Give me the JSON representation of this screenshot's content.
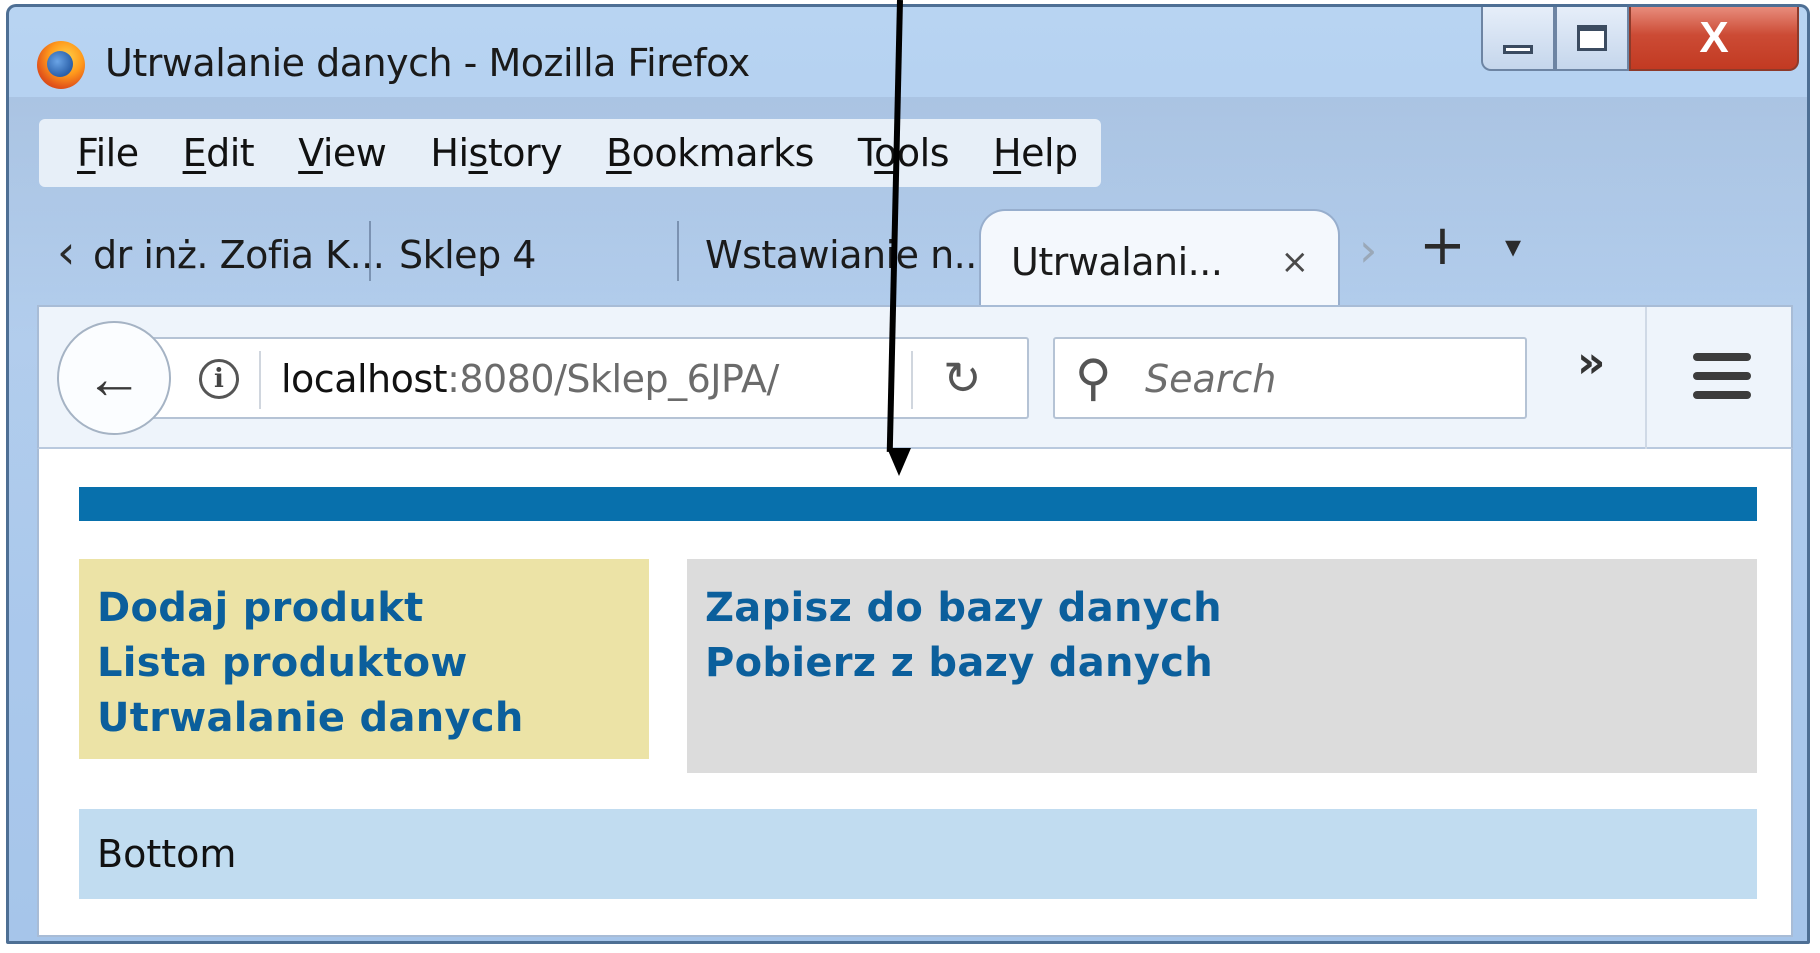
{
  "window": {
    "title": "Utrwalanie danych - Mozilla Firefox",
    "controls": {
      "minimize": "",
      "maximize": "",
      "close": "X"
    }
  },
  "menubar": {
    "items": [
      {
        "label": "File",
        "underline": "F",
        "rest": "ile"
      },
      {
        "label": "Edit",
        "underline": "E",
        "rest": "dit"
      },
      {
        "label": "View",
        "underline": "V",
        "rest": "iew"
      },
      {
        "label": "History",
        "pre": "Hi",
        "underline": "s",
        "rest": "tory"
      },
      {
        "label": "Bookmarks",
        "underline": "B",
        "rest": "ookmarks"
      },
      {
        "label": "Tools",
        "pre": "T",
        "underline": "o",
        "rest": "ols"
      },
      {
        "label": "Help",
        "underline": "H",
        "rest": "elp"
      }
    ]
  },
  "tabs": {
    "items": [
      {
        "label": "dr inż. Zofia K..."
      },
      {
        "label": "Sklep 4"
      },
      {
        "label": "Wstawianie n..."
      },
      {
        "label": "Utrwalani...",
        "active": true
      }
    ],
    "close_glyph": "×",
    "scroll_left_glyph": "‹",
    "scroll_right_glyph": "›",
    "new_tab_glyph": "+",
    "list_tabs_glyph": "▾"
  },
  "navbar": {
    "back_glyph": "🡐",
    "info_glyph": "i",
    "url_host": "localhost",
    "url_rest": ":8080/Sklep_6JPA/",
    "reload_glyph": "↻",
    "search_placeholder": "Search",
    "search_glyph": "⚲",
    "overflow_glyph": "»"
  },
  "page": {
    "left_links": [
      "Dodaj produkt",
      "Lista produktow",
      "Utrwalanie danych"
    ],
    "right_links": [
      "Zapisz do bazy danych",
      "Pobierz z bazy danych"
    ],
    "footer": "Bottom"
  },
  "colors": {
    "header_bar": "#0870ac",
    "left_panel": "#ece3a6",
    "right_panel": "#dcdcdc",
    "footer": "#c1dcf0",
    "link": "#0b5f9c",
    "close_button": "#c23a22"
  }
}
